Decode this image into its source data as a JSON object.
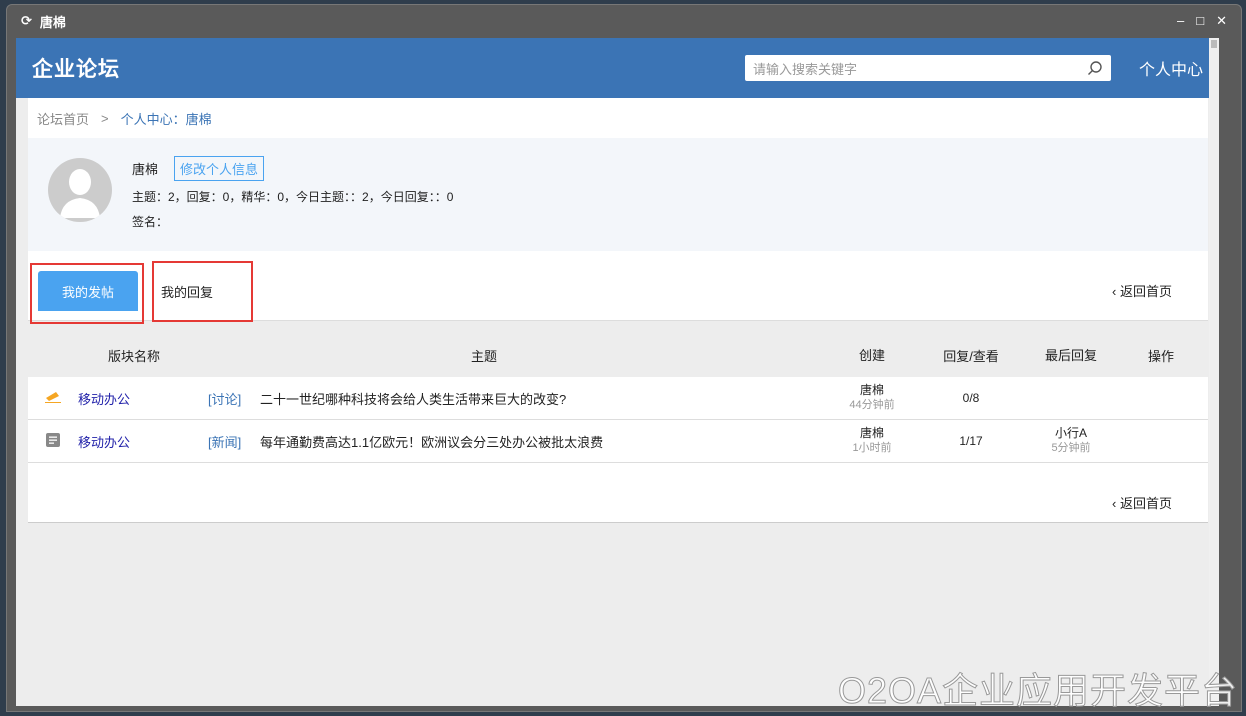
{
  "window": {
    "title": "唐棉",
    "controls": [
      "–",
      "□",
      "✕"
    ]
  },
  "header": {
    "logo": "企业论坛",
    "search_placeholder": "请输入搜索关键字",
    "personal_center": "个人中心"
  },
  "breadcrumb": {
    "home": "论坛首页",
    "sep": ">",
    "current": "个人中心：唐棉"
  },
  "profile": {
    "name": "唐棉",
    "edit_label": "修改个人信息",
    "stats": "主题：2，回复：0，精华：0，今日主题：：2，今日回复：：0",
    "signature": "签名："
  },
  "tabs": {
    "my_posts": "我的发帖",
    "my_replies": "我的回复",
    "back": "返回首页"
  },
  "table": {
    "headers": [
      "版块名称",
      "主题",
      "创建",
      "回复/查看",
      "最后回复",
      "操作"
    ],
    "rows": [
      {
        "icon": "discussion-icon",
        "forum": "移动办公",
        "type": "[讨论]",
        "title": "二十一世纪哪种科技将会给人类生活带来巨大的改变?",
        "author": "唐棉",
        "created": "44分钟前",
        "counts": "0/8",
        "last_user": "",
        "last_time": ""
      },
      {
        "icon": "news-icon",
        "forum": "移动办公",
        "type": "[新闻]",
        "title": "每年通勤费高达1.1亿欧元！欧洲议会分三处办公被批太浪费",
        "author": "唐棉",
        "created": "1小时前",
        "counts": "1/17",
        "last_user": "小行A",
        "last_time": "5分钟前"
      }
    ]
  },
  "footer": {
    "back": "返回首页"
  },
  "watermark": "O2OA企业应用开发平台"
}
